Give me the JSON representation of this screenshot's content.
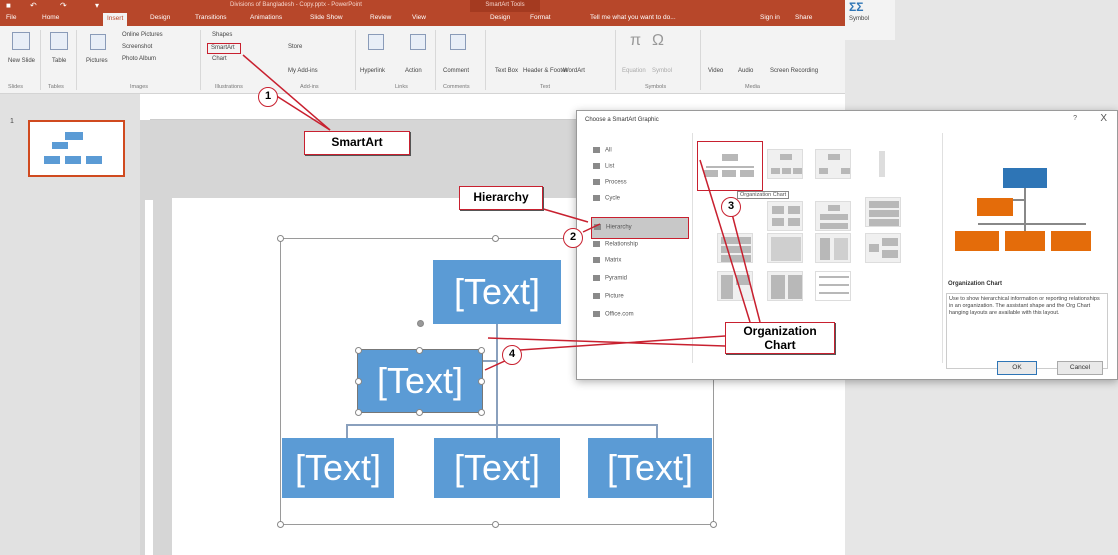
{
  "window": {
    "title": "Divisions of Bangladesh - Copy.pptx - PowerPoint",
    "context_tools": "SmartArt Tools"
  },
  "tabs": [
    {
      "label": "File"
    },
    {
      "label": "Home"
    },
    {
      "label": "Insert"
    },
    {
      "label": "Design"
    },
    {
      "label": "Transitions"
    },
    {
      "label": "Animations"
    },
    {
      "label": "Slide Show"
    },
    {
      "label": "Review"
    },
    {
      "label": "View"
    },
    {
      "label": "Design"
    },
    {
      "label": "Format"
    }
  ],
  "tell_me": "Tell me what you want to do...",
  "sign_in": "Sign in",
  "share": "Share",
  "symbol_label": "Symbol",
  "ribbon": {
    "new_slide": "New Slide",
    "table": "Table",
    "pictures": "Pictures",
    "online_pictures": "Online Pictures",
    "screenshot": "Screenshot",
    "photo_album": "Photo Album",
    "shapes": "Shapes",
    "smartart": "SmartArt",
    "chart": "Chart",
    "store": "Store",
    "my_addins": "My Add-ins",
    "hyperlink": "Hyperlink",
    "action": "Action",
    "comment": "Comment",
    "text_box": "Text Box",
    "header_footer": "Header & Footer",
    "wordart": "WordArt",
    "equation": "Equation",
    "symbol": "Symbol",
    "video": "Video",
    "audio": "Audio",
    "screen_recording": "Screen Recording",
    "groups": {
      "slides": "Slides",
      "tables": "Tables",
      "images": "Images",
      "illustrations": "Illustrations",
      "addins": "Add-ins",
      "links": "Links",
      "comments": "Comments",
      "text": "Text",
      "symbols": "Symbols",
      "media": "Media"
    }
  },
  "slide": {
    "boxes": [
      "[Text]",
      "[Text]",
      "[Text]",
      "[Text]",
      "[Text]"
    ]
  },
  "dialog": {
    "title": "Choose a SmartArt Graphic",
    "help": "?",
    "close": "X",
    "categories": [
      "All",
      "List",
      "Process",
      "Cycle",
      "Hierarchy",
      "Relationship",
      "Matrix",
      "Pyramid",
      "Picture",
      "Office.com"
    ],
    "selected_category": "Hierarchy",
    "tooltip": "Organization Chart",
    "preview_title": "Organization Chart",
    "preview_desc": "Use to show hierarchical information or reporting relationships in an organization. The assistant shape and the Org Chart hanging layouts are available with this layout.",
    "ok": "OK",
    "cancel": "Cancel"
  },
  "callouts": {
    "smartart": "SmartArt",
    "hierarchy": "Hierarchy",
    "org_chart_line1": "Organization",
    "org_chart_line2": "Chart"
  },
  "steps": [
    "1",
    "2",
    "3",
    "4"
  ],
  "colors": {
    "accent": "#b7472a",
    "smartart_blue": "#5b9bd5",
    "annotation_red": "#c8202f",
    "preview_blue": "#2e75b6",
    "preview_orange": "#e46c0a"
  }
}
